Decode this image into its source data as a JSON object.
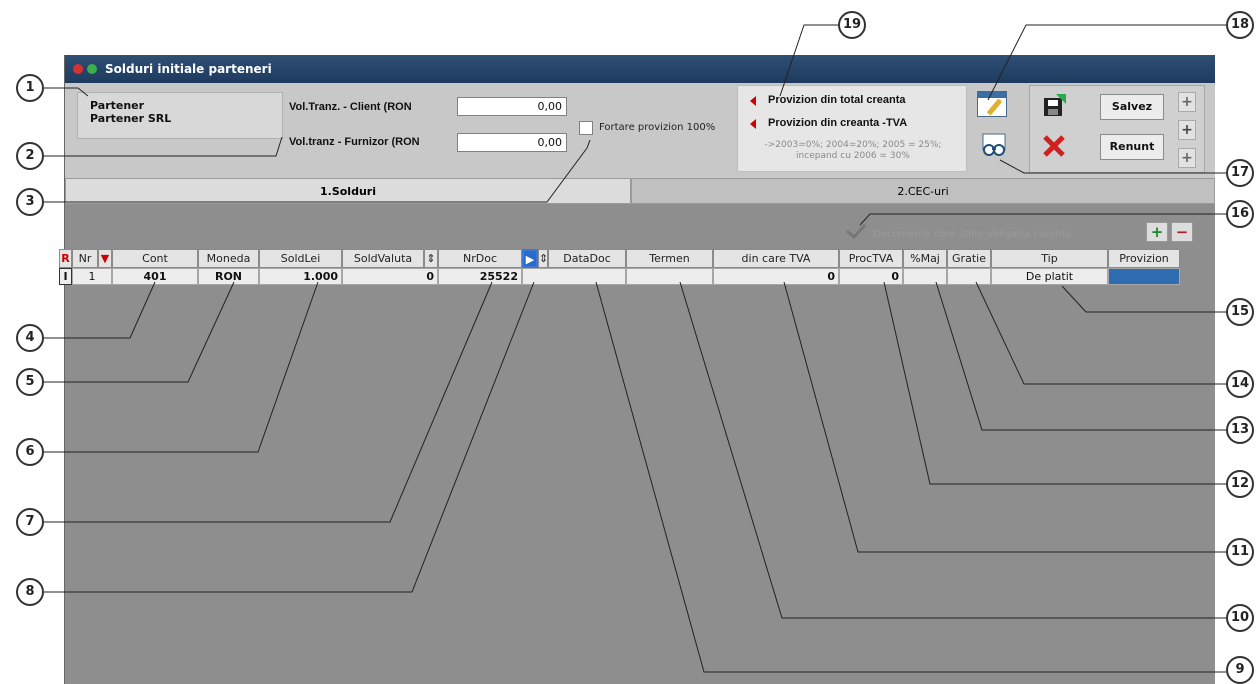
{
  "window": {
    "title": "Solduri initiale parteneri"
  },
  "partner": {
    "label": "Partener",
    "value": "Partener SRL"
  },
  "fields": {
    "vol_client_label": "Vol.Tranz. - Client (RON",
    "vol_client_value": "0,00",
    "vol_furnizor_label": "Vol.tranz - Furnizor (RON",
    "vol_furnizor_value": "0,00",
    "fortare_label": "Fortare provizion 100%"
  },
  "provizion": {
    "option1": "Provizion din total creanta",
    "option2": "Provizion din creanta -TVA",
    "note_line1": "->2003=0%; 2004=20%; 2005 = 25%;",
    "note_line2": "incepand cu 2006 = 30%"
  },
  "buttons": {
    "save": "Salvez",
    "cancel": "Renunt"
  },
  "tabs": [
    {
      "label": "1.Solduri",
      "active": true
    },
    {
      "label": "2.CEC-uri",
      "active": false
    }
  ],
  "docs_note": "Documente care sting obligatia curenta",
  "grid": {
    "headers": [
      "Nr",
      "Cont",
      "Moneda",
      "SoldLei",
      "SoldValuta",
      "NrDoc",
      "DataDoc",
      "Termen",
      "din care TVA",
      "ProcTVA",
      "%Maj",
      "Gratie",
      "Tip",
      "Provizion"
    ],
    "rows": [
      {
        "marker": "I",
        "nr": "1",
        "cont": "401",
        "moneda": "RON",
        "soldlei": "1.000",
        "soldvaluta": "0",
        "nrdoc": "25522",
        "datadoc": "",
        "termen": "",
        "tva": "0",
        "proctva": "0",
        "maj": "",
        "gratie": "",
        "tip": "De platit",
        "provizion": ""
      }
    ]
  },
  "callouts": [
    "1",
    "2",
    "3",
    "4",
    "5",
    "6",
    "7",
    "8",
    "9",
    "10",
    "11",
    "12",
    "13",
    "14",
    "15",
    "16",
    "17",
    "18",
    "19"
  ],
  "colors": {
    "titlebar": "#1e3a5f",
    "accent_red": "#cc0000",
    "provizion_cell": "#2e6db0"
  }
}
